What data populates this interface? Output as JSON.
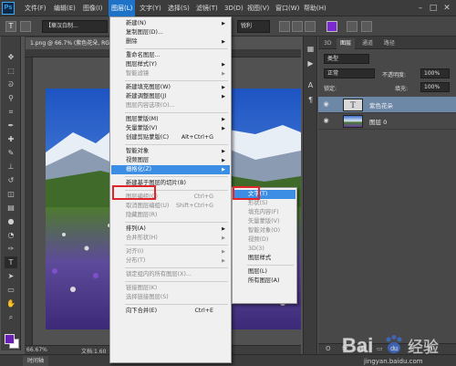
{
  "menubar": {
    "logo": "Ps",
    "items": [
      "文件(F)",
      "编辑(E)",
      "图像(I)",
      "图层(L)",
      "文字(Y)",
      "选择(S)",
      "滤镜(T)",
      "3D(D)",
      "视图(V)",
      "窗口(W)",
      "帮助(H)"
    ],
    "window_buttons": [
      "–",
      "□",
      "✕"
    ]
  },
  "options": {
    "font_name": "【華汉白制...",
    "font_size": "7",
    "antialias": "锐利"
  },
  "document": {
    "tab": "1.png @ 66.7% (紫色花朵, RGB/8)",
    "zoom": "66.67%",
    "doc_info": "文档:1.60"
  },
  "timeline": {
    "tab": "时间轴"
  },
  "layers_panel": {
    "tabs": [
      "3D",
      "图层",
      "通道",
      "路径"
    ],
    "filter": "类型",
    "blend_mode": "正常",
    "opacity_label": "不透明度:",
    "opacity": "100%",
    "lock_label": "锁定:",
    "fill_label": "填充:",
    "fill": "100%",
    "layers": [
      {
        "thumb": "T",
        "name": "紫色花朵",
        "active": true
      },
      {
        "thumb": "",
        "name": "图层 0",
        "active": false
      }
    ],
    "footer_icons": [
      "ʘ",
      "fx",
      "◐",
      "▭",
      "▤",
      "⊞",
      "🗑"
    ]
  },
  "layer_menu": {
    "items": [
      {
        "label": "新建(N)",
        "submenu": true,
        "disabled": false
      },
      {
        "label": "复制图层(D)...",
        "disabled": false
      },
      {
        "label": "删除",
        "submenu": true,
        "disabled": false
      },
      {
        "sep": true
      },
      {
        "label": "重命名图层...",
        "disabled": false
      },
      {
        "label": "图层样式(Y)",
        "submenu": true,
        "disabled": false
      },
      {
        "label": "智能滤镜",
        "submenu": true,
        "disabled": true
      },
      {
        "sep": true
      },
      {
        "label": "新建填充图层(W)",
        "submenu": true,
        "disabled": false
      },
      {
        "label": "新建调整图层(J)",
        "submenu": true,
        "disabled": false
      },
      {
        "label": "图层内容选项(O)...",
        "disabled": true
      },
      {
        "sep": true
      },
      {
        "label": "图层蒙版(M)",
        "submenu": true,
        "disabled": false
      },
      {
        "label": "矢量蒙版(V)",
        "submenu": true,
        "disabled": false
      },
      {
        "label": "创建剪贴蒙版(C)",
        "shortcut": "Alt+Ctrl+G",
        "disabled": false
      },
      {
        "sep": true
      },
      {
        "label": "智能对象",
        "submenu": true,
        "disabled": false
      },
      {
        "label": "视频图层",
        "submenu": true,
        "disabled": false
      },
      {
        "label": "栅格化(Z)",
        "submenu": true,
        "disabled": false,
        "highlight": true
      },
      {
        "sep": true
      },
      {
        "label": "新建基于图层的切片(B)",
        "disabled": false
      },
      {
        "sep": true
      },
      {
        "label": "图层编组(G)",
        "shortcut": "Ctrl+G",
        "disabled": true
      },
      {
        "label": "取消图层编组(U)",
        "shortcut": "Shift+Ctrl+G",
        "disabled": true
      },
      {
        "label": "隐藏图层(R)",
        "disabled": true
      },
      {
        "sep": true
      },
      {
        "label": "排列(A)",
        "submenu": true,
        "disabled": false
      },
      {
        "label": "合并形状(H)",
        "submenu": true,
        "disabled": true
      },
      {
        "sep": true
      },
      {
        "label": "对齐(I)",
        "submenu": true,
        "disabled": true
      },
      {
        "label": "分布(T)",
        "submenu": true,
        "disabled": true
      },
      {
        "sep": true
      },
      {
        "label": "锁定组内的所有图层(X)...",
        "disabled": true
      },
      {
        "sep": true
      },
      {
        "label": "链接图层(K)",
        "disabled": true
      },
      {
        "label": "选择链接图层(S)",
        "disabled": true
      },
      {
        "sep": true
      },
      {
        "label": "向下合并(E)",
        "shortcut": "Ctrl+E",
        "disabled": false
      }
    ]
  },
  "rasterize_submenu": {
    "items": [
      {
        "label": "文字(T)",
        "disabled": false,
        "highlight": true
      },
      {
        "label": "形状(S)",
        "disabled": true
      },
      {
        "label": "填充内容(F)",
        "disabled": true
      },
      {
        "label": "矢量蒙版(V)",
        "disabled": true
      },
      {
        "label": "智能对象(O)",
        "disabled": true
      },
      {
        "label": "视频(D)",
        "disabled": true
      },
      {
        "label": "3D(3)",
        "disabled": true
      },
      {
        "label": "图层样式",
        "disabled": false
      },
      {
        "sep": true
      },
      {
        "label": "图层(L)",
        "disabled": false
      },
      {
        "label": "所有图层(A)",
        "disabled": false
      }
    ]
  },
  "watermark": {
    "brand": "Bai",
    "paw": "du",
    "suffix": "经验",
    "url": "jingyan.baidu.com"
  },
  "colors": {
    "menu_highlight": "#3c8ee4",
    "red_box": "#e0262a",
    "foreground": "#6a1fb5",
    "layer_active": "#6d87a7"
  }
}
